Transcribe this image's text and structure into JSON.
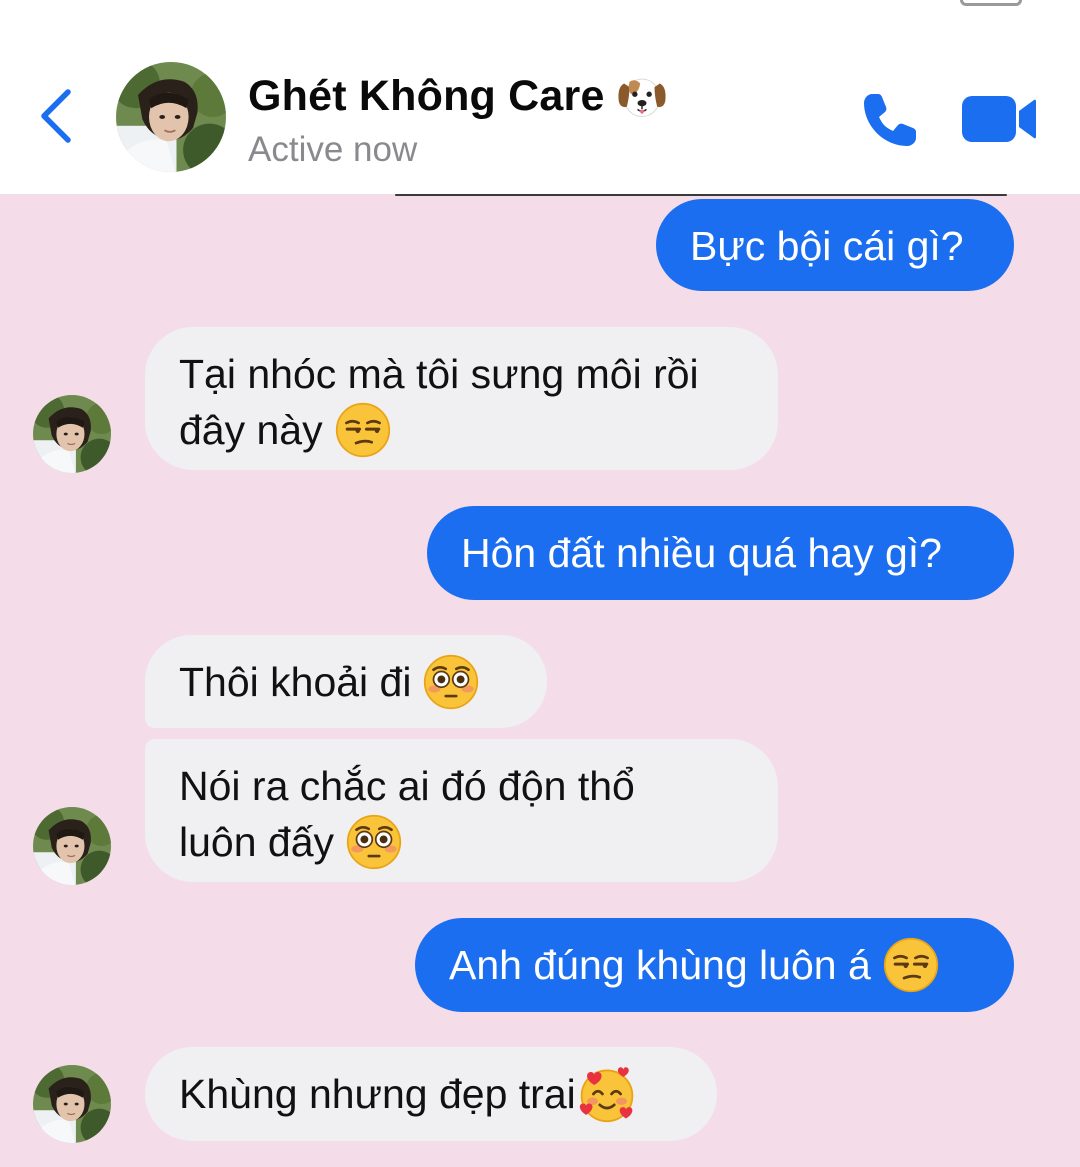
{
  "header": {
    "contact_name": "Ghét Không Care",
    "status": "Active now",
    "name_icon": "dog-face-icon",
    "back_icon": "chevron-left-icon",
    "call_icon": "phone-icon",
    "video_icon": "video-camera-icon"
  },
  "messages": [
    {
      "direction": "outgoing",
      "text": "Bực bội cái gì?"
    },
    {
      "direction": "incoming",
      "text_line1": "Tại nhóc mà tôi sưng môi rồi",
      "text_line2": "đây này",
      "emoji": "unamused-face-icon"
    },
    {
      "direction": "outgoing",
      "text": "Hôn đất nhiều quá hay gì?"
    },
    {
      "direction": "incoming",
      "text": "Thôi khoải đi",
      "emoji": "flushed-face-icon"
    },
    {
      "direction": "incoming",
      "text_line1": "Nói ra chắc ai đó độn thổ",
      "text_line2": "luôn đấy",
      "emoji": "flushed-face-icon"
    },
    {
      "direction": "outgoing",
      "text": "Anh đúng khùng luôn á",
      "emoji": "unamused-face-icon"
    },
    {
      "direction": "incoming",
      "text": "Khùng nhưng đẹp trai",
      "emoji": "smiling-face-with-hearts-icon"
    }
  ],
  "colors": {
    "accent": "#1c6ef0",
    "chat_background": "#f4dde9",
    "incoming_bubble": "#f0eff2",
    "status_text": "#8a8a8e"
  }
}
